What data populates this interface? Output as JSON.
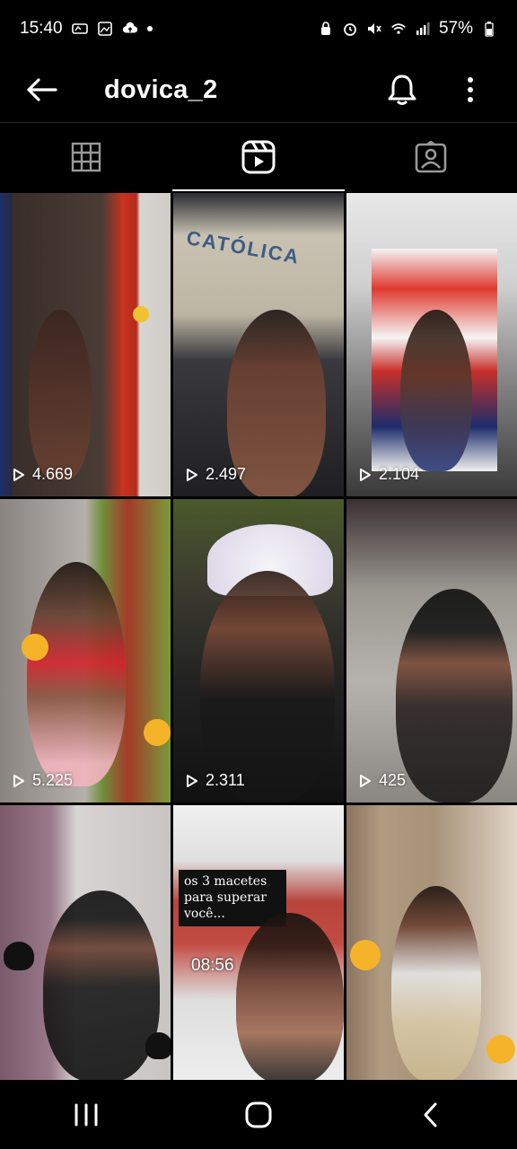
{
  "status_bar": {
    "time": "15:40",
    "battery": "57%"
  },
  "header": {
    "username": "dovica_2"
  },
  "tabs": [
    {
      "name": "grid-icon",
      "active": false
    },
    {
      "name": "reels-icon",
      "active": true
    },
    {
      "name": "tagged-icon",
      "active": false
    }
  ],
  "reels": [
    {
      "views": "4.669"
    },
    {
      "views": "2.497"
    },
    {
      "views": "2.104"
    },
    {
      "views": "5.225"
    },
    {
      "views": "2.311"
    },
    {
      "views": "425"
    },
    {
      "views": ""
    },
    {
      "views": "",
      "caption": "os 3 macetes para superar você...",
      "overlay_time": "08:56"
    },
    {
      "views": ""
    }
  ],
  "wall_sign": "CATÓLICA",
  "colors": {
    "background": "#000000",
    "text": "#ffffff",
    "divider": "#262626"
  }
}
